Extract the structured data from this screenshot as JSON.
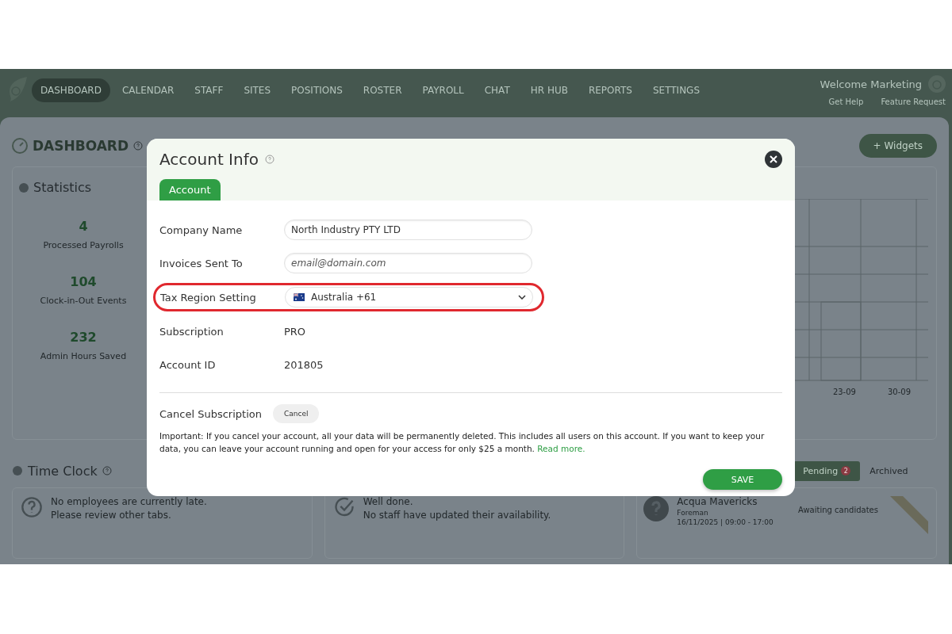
{
  "nav": {
    "items": [
      {
        "label": "DASHBOARD",
        "selected": true
      },
      {
        "label": "CALENDAR",
        "selected": false
      },
      {
        "label": "STAFF",
        "selected": false
      },
      {
        "label": "SITES",
        "selected": false
      },
      {
        "label": "POSITIONS",
        "selected": false
      },
      {
        "label": "ROSTER",
        "selected": false
      },
      {
        "label": "PAYROLL",
        "selected": false
      },
      {
        "label": "CHAT",
        "selected": false
      },
      {
        "label": "HR HUB",
        "selected": false
      },
      {
        "label": "REPORTS",
        "selected": false
      },
      {
        "label": "SETTINGS",
        "selected": false
      }
    ],
    "welcome": "Welcome Marketing",
    "links": [
      "Get Help",
      "Feature Request"
    ]
  },
  "dashboard": {
    "title": "DASHBOARD",
    "widgets_button": "+ Widgets",
    "statistics": {
      "title": "Statistics",
      "items": [
        {
          "value": "4",
          "label": "Processed Payrolls"
        },
        {
          "value": "104",
          "label": "Clock-in-Out Events"
        },
        {
          "value": "232",
          "label": "Admin Hours Saved"
        }
      ]
    },
    "chart": {
      "x_labels": [
        "23-09",
        "30-09"
      ]
    },
    "time_clock": {
      "title": "Time Clock"
    },
    "shift_tabs": [
      {
        "label": "Pending",
        "badge": "2",
        "selected": true
      },
      {
        "label": "Archived",
        "selected": false
      }
    ],
    "notices": [
      {
        "kind": "question",
        "lines": [
          "No employees are currently late.",
          "Please review other tabs."
        ]
      },
      {
        "kind": "check",
        "lines": [
          "Well done.",
          "No staff have updated their availability."
        ]
      }
    ],
    "shift": {
      "name": "Acqua Mavericks",
      "role": "Foreman",
      "time": "16/11/2025 | 09:00 - 17:00",
      "status": "Awaiting candidates"
    }
  },
  "modal": {
    "title": "Account Info",
    "tabs": [
      {
        "label": "Account",
        "selected": true
      }
    ],
    "fields": [
      {
        "kind": "input",
        "label": "Company Name",
        "value": "North Industry PTY LTD",
        "highlighted": false
      },
      {
        "kind": "input",
        "label": "Invoices Sent To",
        "placeholder": "email@domain.com",
        "highlighted": false
      },
      {
        "kind": "select",
        "label": "Tax Region Setting",
        "value": "Australia +61",
        "highlighted": true
      },
      {
        "kind": "text",
        "label": "Subscription",
        "value": "PRO",
        "highlighted": false
      },
      {
        "kind": "text",
        "label": "Account ID",
        "value": "201805",
        "highlighted": false
      }
    ],
    "cancel": {
      "label": "Cancel Subscription",
      "button": "Cancel"
    },
    "notice": {
      "text": "Important: If you cancel your account, all your data will be permanently deleted. This includes all users on this account. If you want to keep your data, you can leave your account running and open for your access for only $25 a month.",
      "link": "Read more."
    },
    "save": "SAVE"
  }
}
